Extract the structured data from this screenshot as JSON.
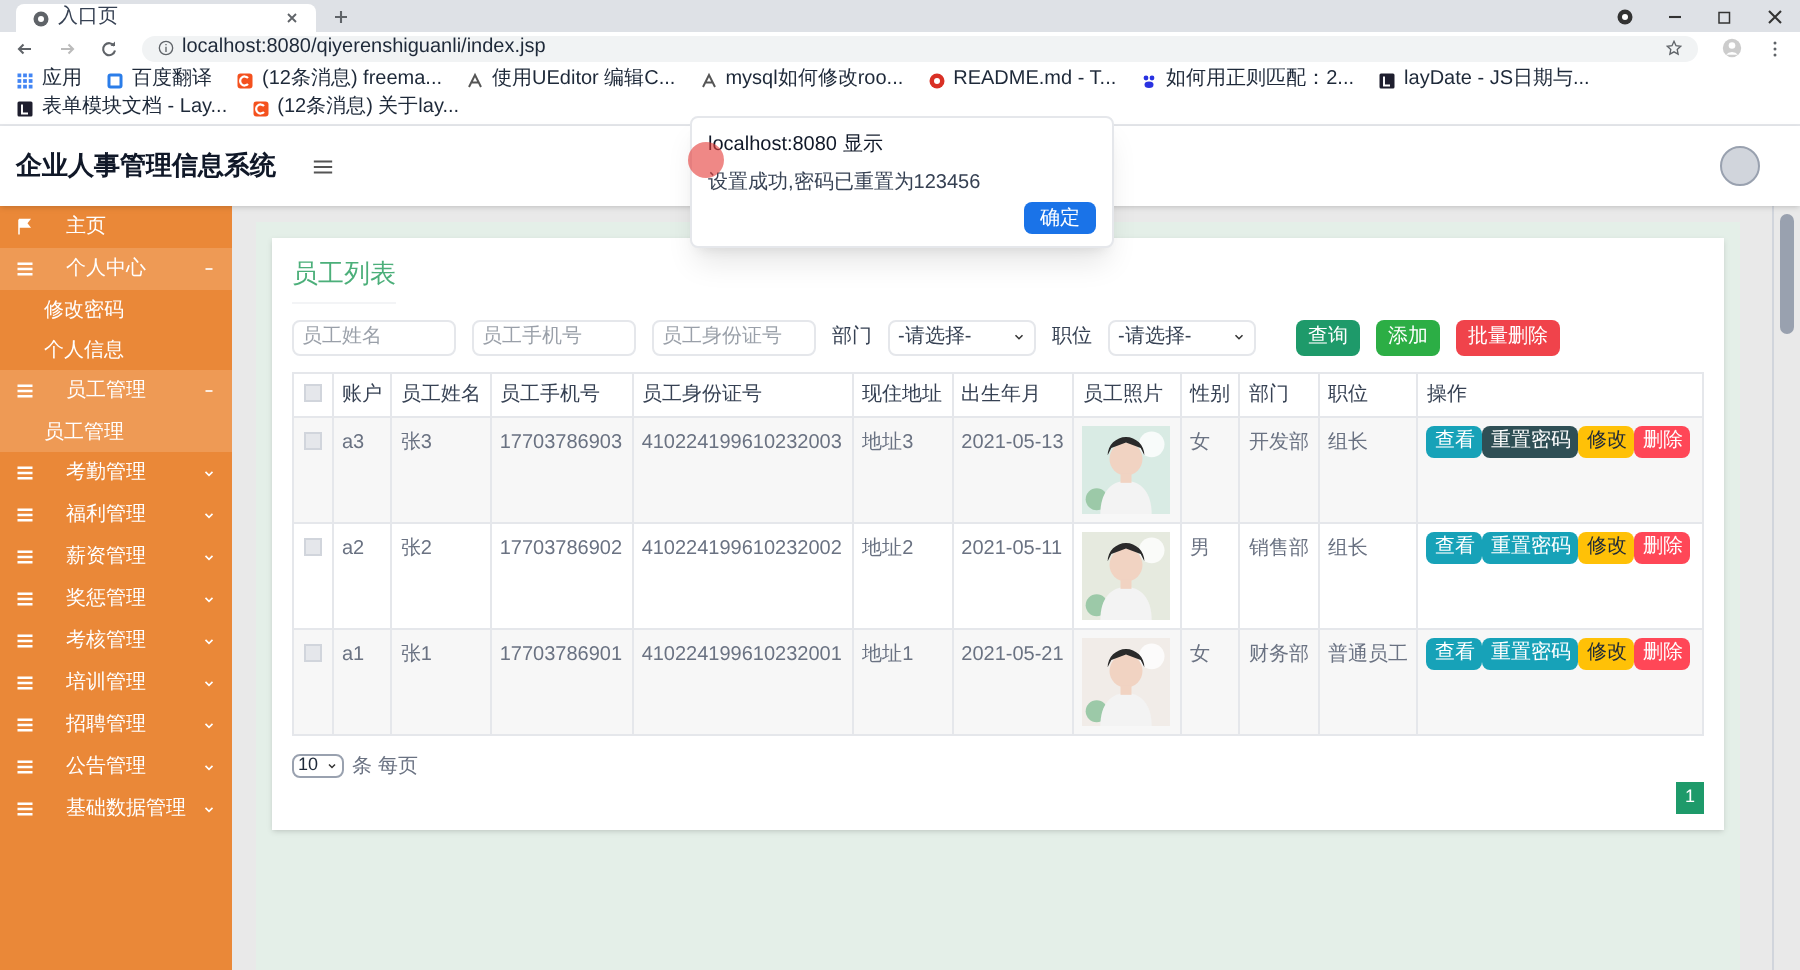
{
  "browser": {
    "tab_title": "入口页",
    "url": "localhost:8080/qiyerenshiguanli/index.jsp",
    "bookmarks": [
      {
        "label": "应用",
        "kind": "apps"
      },
      {
        "label": "百度翻译",
        "kind": "translate"
      },
      {
        "label": "(12条消息) freema...",
        "kind": "csdn"
      },
      {
        "label": "使用UEditor 编辑C...",
        "kind": "web"
      },
      {
        "label": "mysql如何修改roo...",
        "kind": "web"
      },
      {
        "label": "README.md - T...",
        "kind": "git"
      },
      {
        "label": "如何用正则匹配：2...",
        "kind": "baidu"
      },
      {
        "label": "layDate - JS日期与...",
        "kind": "layui"
      },
      {
        "label": "表单模块文档 - Lay...",
        "kind": "layui"
      },
      {
        "label": "(12条消息) 关于lay...",
        "kind": "csdn"
      }
    ]
  },
  "dialog": {
    "title": "localhost:8080 显示",
    "message": "设置成功,密码已重置为123456",
    "button": "确定"
  },
  "header": {
    "title": "企业人事管理信息系统"
  },
  "sidebar": {
    "items": [
      {
        "label": "主页",
        "kind": "home",
        "expanded": false
      },
      {
        "label": "个人中心",
        "kind": "menu",
        "expanded": true,
        "children": [
          {
            "label": "修改密码",
            "selected": false
          },
          {
            "label": "个人信息",
            "selected": false
          }
        ]
      },
      {
        "label": "员工管理",
        "kind": "menu",
        "expanded": true,
        "children": [
          {
            "label": "员工管理",
            "selected": true
          }
        ]
      },
      {
        "label": "考勤管理",
        "kind": "menu",
        "expanded": false
      },
      {
        "label": "福利管理",
        "kind": "menu",
        "expanded": false
      },
      {
        "label": "薪资管理",
        "kind": "menu",
        "expanded": false
      },
      {
        "label": "奖惩管理",
        "kind": "menu",
        "expanded": false
      },
      {
        "label": "考核管理",
        "kind": "menu",
        "expanded": false
      },
      {
        "label": "培训管理",
        "kind": "menu",
        "expanded": false
      },
      {
        "label": "招聘管理",
        "kind": "menu",
        "expanded": false
      },
      {
        "label": "公告管理",
        "kind": "menu",
        "expanded": false
      },
      {
        "label": "基础数据管理",
        "kind": "menu",
        "expanded": false
      }
    ]
  },
  "panel": {
    "title": "员工列表",
    "filters": [
      {
        "kind": "input",
        "placeholder": "员工姓名"
      },
      {
        "kind": "input",
        "placeholder": "员工手机号"
      },
      {
        "kind": "input",
        "placeholder": "员工身份证号"
      },
      {
        "kind": "select",
        "label": "部门",
        "value": "-请选择-"
      },
      {
        "kind": "select",
        "label": "职位",
        "value": "-请选择-"
      }
    ],
    "actions": [
      {
        "label": "查询",
        "kind": "search"
      },
      {
        "label": "添加",
        "kind": "add"
      },
      {
        "label": "批量删除",
        "kind": "delete"
      }
    ],
    "table": {
      "all_checked": false,
      "columns": [
        "账户",
        "员工姓名",
        "员工手机号",
        "员工身份证号",
        "现住地址",
        "出生年月",
        "员工照片",
        "性别",
        "部门",
        "职位",
        "操作"
      ],
      "rows": [
        {
          "checked": false,
          "cells": [
            "a3",
            "张3",
            "17703786903",
            "410224199610232003",
            "地址3",
            "2021-05-13"
          ],
          "photo": {
            "kind": "picture"
          },
          "cells2": [
            "女",
            "开发部",
            "组长"
          ],
          "buttons": [
            {
              "label": "查看",
              "kind": "view",
              "highlighted": false
            },
            {
              "label": "重置密码",
              "kind": "reset",
              "highlighted": true
            },
            {
              "label": "修改",
              "kind": "edit",
              "highlighted": false
            },
            {
              "label": "删除",
              "kind": "delete",
              "highlighted": false
            }
          ]
        },
        {
          "checked": false,
          "cells": [
            "a2",
            "张2",
            "17703786902",
            "410224199610232002",
            "地址2",
            "2021-05-11"
          ],
          "photo": {
            "kind": "picture"
          },
          "cells2": [
            "男",
            "销售部",
            "组长"
          ],
          "buttons": [
            {
              "label": "查看",
              "kind": "view",
              "highlighted": false
            },
            {
              "label": "重置密码",
              "kind": "reset",
              "highlighted": false
            },
            {
              "label": "修改",
              "kind": "edit",
              "highlighted": false
            },
            {
              "label": "删除",
              "kind": "delete",
              "highlighted": false
            }
          ]
        },
        {
          "checked": false,
          "cells": [
            "a1",
            "张1",
            "17703786901",
            "410224199610232001",
            "地址1",
            "2021-05-21"
          ],
          "photo": {
            "kind": "picture"
          },
          "cells2": [
            "女",
            "财务部",
            "普通员工"
          ],
          "buttons": [
            {
              "label": "查看",
              "kind": "view",
              "highlighted": false
            },
            {
              "label": "重置密码",
              "kind": "reset",
              "highlighted": false
            },
            {
              "label": "修改",
              "kind": "edit",
              "highlighted": false
            },
            {
              "label": "删除",
              "kind": "delete",
              "highlighted": false
            }
          ]
        }
      ]
    },
    "page_size": {
      "value": "10",
      "label": "条 每页"
    },
    "pages": [
      {
        "label": "1",
        "selected": true
      }
    ]
  }
}
